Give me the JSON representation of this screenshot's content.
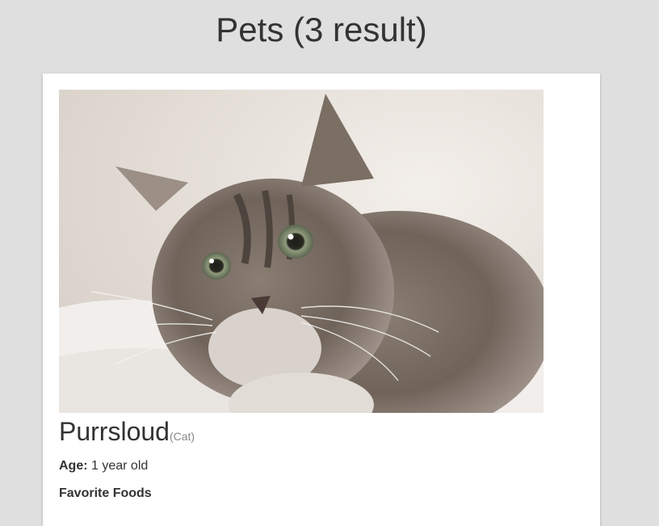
{
  "header": {
    "title": "Pets (3 result)"
  },
  "pets": [
    {
      "name": "Purrsloud",
      "species": "(Cat)",
      "age_label": "Age:",
      "age_value": " 1 year old",
      "foods_heading": "Favorite Foods",
      "photo_icon": "kitten-photo"
    }
  ],
  "colors": {
    "background": "#dfdfdf",
    "card": "#ffffff",
    "text": "#333333",
    "muted": "#888888"
  }
}
